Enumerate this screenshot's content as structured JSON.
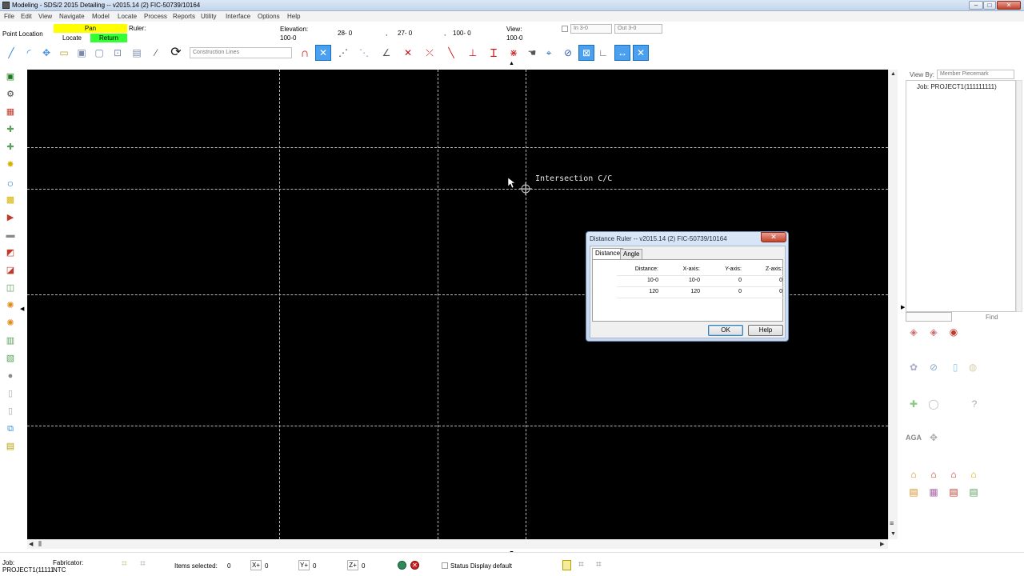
{
  "window": {
    "title": "Modeling - SDS/2 2015 Detailing  --  v2015.14  (2) FIC-50739/10164",
    "controls": {
      "minimize": "–",
      "maximize": "□",
      "close": "✕"
    }
  },
  "menu": [
    "File",
    "Edit",
    "View",
    "Navigate",
    "Model",
    "Locate",
    "Process",
    "Reports",
    "Utility",
    "Interface",
    "Options",
    "Help"
  ],
  "status_row": {
    "mode_label": "Point Location",
    "pan_label": "Pan",
    "locate_label": "Locate",
    "return_label": "Return",
    "ruler_label": "Ruler:",
    "elevation_label": "Elevation:",
    "elevation_value": "100-0",
    "coord_x": "28- 0",
    "coord_sep1": ",",
    "coord_y": "27- 0",
    "coord_sep2": ",",
    "coord_z": "100- 0",
    "view_label": "View:",
    "view_value": "100-0",
    "in_value": "In 3-0",
    "out_value": "Out 3-0",
    "colors": {
      "pan": "#ffff00",
      "return": "#33ff33"
    }
  },
  "toolbar": {
    "construction_lines": "Construction Lines"
  },
  "canvas": {
    "label": "Intersection C/C",
    "background": "#000000",
    "grid_color": "#b8b8b8"
  },
  "right_panel": {
    "view_by_label": "View By:",
    "view_by_value": "Member Piecemark",
    "tree_item": "Job: PROJECT1(111111111)",
    "find_label": "Find",
    "aga_label": "AGA"
  },
  "statusbar": {
    "job_label": "Job:",
    "job_value": "PROJECT1(11111",
    "fabricator_label": "Fabricator:",
    "fabricator_value": "NTC",
    "items_selected_label": "Items selected:",
    "items_selected_value": "0",
    "x_label": "X+",
    "x_value": "0",
    "y_label": "Y+",
    "y_value": "0",
    "z_label": "Z+",
    "z_value": "0",
    "status_display_label": "Status Display",
    "status_display_value": "default"
  },
  "dialog": {
    "title": "Distance Ruler  --  v2015.14  (2) FIC-50739/10164",
    "close": "✕",
    "tabs": [
      "Distance",
      "Angle"
    ],
    "columns": [
      "Distance:",
      "X-axis:",
      "Y-axis:",
      "Z-axis:"
    ],
    "rows": [
      [
        "10-0",
        "10-0",
        "0",
        "0"
      ],
      [
        "120",
        "120",
        "0",
        "0"
      ]
    ],
    "ok_label": "OK",
    "help_label": "Help"
  }
}
